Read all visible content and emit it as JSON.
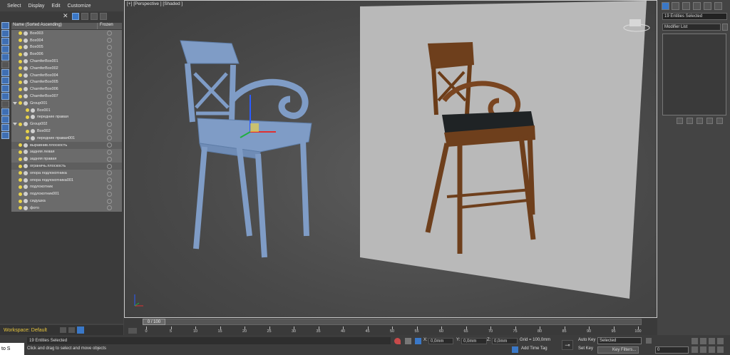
{
  "menu": [
    "Select",
    "Display",
    "Edit",
    "Customize"
  ],
  "explorer": {
    "col_name": "Name (Sorted Ascending)",
    "col_frozen": "Frozen",
    "rows": [
      {
        "label": "Box003",
        "indent": 0,
        "state": "sel"
      },
      {
        "label": "Box004",
        "indent": 0,
        "state": "sel"
      },
      {
        "label": "Box005",
        "indent": 0,
        "state": "sel"
      },
      {
        "label": "Box006",
        "indent": 0,
        "state": "sel"
      },
      {
        "label": "ChamferBox001",
        "indent": 0,
        "state": "sel"
      },
      {
        "label": "ChamferBox002",
        "indent": 0,
        "state": "sel"
      },
      {
        "label": "ChamferBox004",
        "indent": 0,
        "state": "sel"
      },
      {
        "label": "ChamferBox005",
        "indent": 0,
        "state": "sel"
      },
      {
        "label": "ChamferBox006",
        "indent": 0,
        "state": "sel"
      },
      {
        "label": "ChamferBox007",
        "indent": 0,
        "state": "sel"
      },
      {
        "label": "Group001",
        "indent": 0,
        "state": "sel",
        "group": true
      },
      {
        "label": "Box001",
        "indent": 1,
        "state": "sel"
      },
      {
        "label": "передние правая",
        "indent": 1,
        "state": "sel"
      },
      {
        "label": "Group002",
        "indent": 0,
        "state": "sel",
        "group": true
      },
      {
        "label": "Box002",
        "indent": 1,
        "state": "sel"
      },
      {
        "label": "передние правая001",
        "indent": 1,
        "state": "sel"
      },
      {
        "label": "выравнив.плоскость",
        "indent": 0,
        "state": "hi"
      },
      {
        "label": "задняя левая",
        "indent": 0,
        "state": "sel"
      },
      {
        "label": "задняя правая",
        "indent": 0,
        "state": "sel"
      },
      {
        "label": "ограничь.плоскость",
        "indent": 0,
        "state": "hi"
      },
      {
        "label": "опора подлокотника",
        "indent": 0,
        "state": "sel"
      },
      {
        "label": "опора подлокотника001",
        "indent": 0,
        "state": "sel"
      },
      {
        "label": "подлокотник",
        "indent": 0,
        "state": "sel"
      },
      {
        "label": "подлокотник001",
        "indent": 0,
        "state": "sel"
      },
      {
        "label": "сидушка",
        "indent": 0,
        "state": "sel"
      },
      {
        "label": "фото",
        "indent": 0,
        "state": "sel"
      }
    ]
  },
  "workspace": "Workspace: Default",
  "viewport": {
    "label": "[+] [Perspective ] [Shaded ]"
  },
  "timeline": {
    "slider": "0 / 100",
    "ticks": [
      "0",
      "5",
      "10",
      "15",
      "20",
      "25",
      "30",
      "35",
      "40",
      "45",
      "50",
      "55",
      "60",
      "65",
      "70",
      "75",
      "80",
      "85",
      "90",
      "95",
      "100"
    ]
  },
  "command_panel": {
    "selection": "19 Entities Selected",
    "modifier_list": "Modifier List"
  },
  "status": {
    "maxscript": "to S",
    "selection": "19 Entities Selected",
    "prompt": "Click and drag to select and move objects",
    "x_label": "X:",
    "x": "0,0mm",
    "y_label": "Y:",
    "y": "0,0mm",
    "z_label": "Z:",
    "z": "0,0mm",
    "grid": "Grid = 100,0mm",
    "add_time_tag": "Add Time Tag",
    "auto_key": "Auto Key",
    "set_key": "Set Key",
    "selected": "Selected",
    "key_filters": "Key Filters...",
    "frame": "0"
  },
  "colors": {
    "accent": "#3a78c8",
    "chair_model": "#7f9cc6",
    "workspace": "#e7c53e"
  }
}
